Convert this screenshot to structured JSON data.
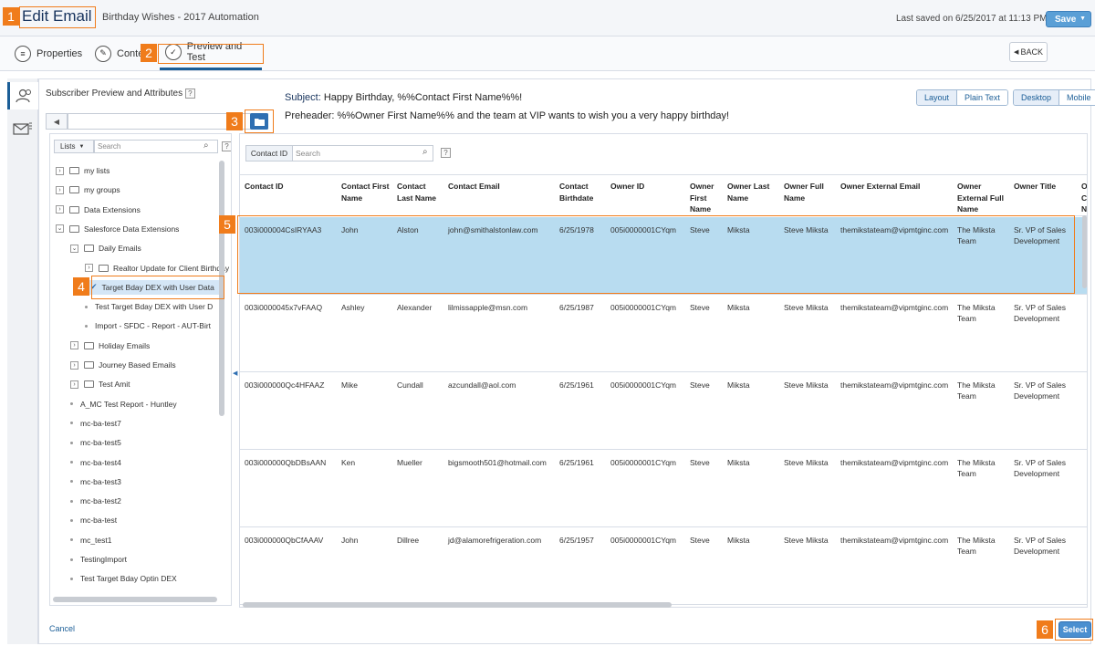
{
  "header": {
    "title": "Edit Email",
    "subtitle": "Birthday Wishes - 2017 Automation",
    "last_saved": "Last saved on 6/25/2017 at 11:13 PM",
    "save_label": "Save"
  },
  "tabs": [
    {
      "label": "Properties"
    },
    {
      "label": "Conte"
    },
    {
      "label": "Preview and Test"
    }
  ],
  "back_label": "BACK",
  "attributes_title": "Subscriber Preview and Attributes",
  "help_glyph": "?",
  "subject": {
    "label": "Subject:",
    "value": "Happy Birthday, %%Contact First Name%%!"
  },
  "preheader": {
    "label": "Preheader:",
    "value": "%%Owner First Name%% and the team at VIP wants to wish you a very happy birthday!"
  },
  "view_toggle": [
    "Layout",
    "Plain Text"
  ],
  "device_toggle": [
    "Desktop",
    "Mobile"
  ],
  "tree": {
    "lists_label": "Lists",
    "search_placeholder": "Search",
    "nodes": [
      {
        "label": "my lists",
        "type": "folder",
        "level": 0
      },
      {
        "label": "my groups",
        "type": "folder",
        "level": 0
      },
      {
        "label": "Data Extensions",
        "type": "folder",
        "level": 0
      },
      {
        "label": "Salesforce Data Extensions",
        "type": "folder-open",
        "level": 0
      },
      {
        "label": "Daily Emails",
        "type": "folder-open",
        "level": 1
      },
      {
        "label": "Realtor Update for Client Birthday",
        "type": "folder",
        "level": 2
      },
      {
        "label": "Target Bday DEX with User Data",
        "type": "selected",
        "level": 2
      },
      {
        "label": "Test Target Bday DEX with User D",
        "type": "leaf",
        "level": 2
      },
      {
        "label": "Import - SFDC - Report - AUT-Birt",
        "type": "leaf",
        "level": 2
      },
      {
        "label": "Holiday Emails",
        "type": "folder",
        "level": 1
      },
      {
        "label": "Journey Based Emails",
        "type": "folder",
        "level": 1
      },
      {
        "label": "Test Amit",
        "type": "folder",
        "level": 1
      },
      {
        "label": "A_MC Test Report - Huntley",
        "type": "leaf",
        "level": 1
      },
      {
        "label": "mc-ba-test7",
        "type": "leaf",
        "level": 1
      },
      {
        "label": "mc-ba-test5",
        "type": "leaf",
        "level": 1
      },
      {
        "label": "mc-ba-test4",
        "type": "leaf",
        "level": 1
      },
      {
        "label": "mc-ba-test3",
        "type": "leaf",
        "level": 1
      },
      {
        "label": "mc-ba-test2",
        "type": "leaf",
        "level": 1
      },
      {
        "label": "mc-ba-test",
        "type": "leaf",
        "level": 1
      },
      {
        "label": "mc_test1",
        "type": "leaf",
        "level": 1
      },
      {
        "label": "TestingImport",
        "type": "leaf",
        "level": 1
      },
      {
        "label": "Test Target Bday Optin DEX",
        "type": "leaf",
        "level": 1
      }
    ]
  },
  "grid": {
    "field_label": "Contact ID",
    "search_placeholder": "Search",
    "columns": [
      "Contact ID",
      "Contact First Name",
      "Contact Last Name",
      "Contact Email",
      "Contact Birthdate",
      "Owner ID",
      "Owner First Name",
      "Owner Last Name",
      "Owner Full Name",
      "Owner External Email",
      "Owner External Full Name",
      "Owner Title",
      "O C N"
    ],
    "rows": [
      [
        "003i000004CsIRYAA3",
        "John",
        "Alston",
        "john@smithalstonlaw.com",
        "6/25/1978",
        "005i0000001CYqm",
        "Steve",
        "Miksta",
        "Steve Miksta",
        "themikstateam@vipmtginc.com",
        "The Miksta Team",
        "Sr. VP of Sales Development"
      ],
      [
        "003i0000045x7vFAAQ",
        "Ashley",
        "Alexander",
        "lilmissapple@msn.com",
        "6/25/1987",
        "005i0000001CYqm",
        "Steve",
        "Miksta",
        "Steve Miksta",
        "themikstateam@vipmtginc.com",
        "The Miksta Team",
        "Sr. VP of Sales Development"
      ],
      [
        "003i000000Qc4HFAAZ",
        "Mike",
        "Cundall",
        "azcundall@aol.com",
        "6/25/1961",
        "005i0000001CYqm",
        "Steve",
        "Miksta",
        "Steve Miksta",
        "themikstateam@vipmtginc.com",
        "The Miksta Team",
        "Sr. VP of Sales Development"
      ],
      [
        "003i000000QbDBsAAN",
        "Ken",
        "Mueller",
        "bigsmooth501@hotmail.com",
        "6/25/1961",
        "005i0000001CYqm",
        "Steve",
        "Miksta",
        "Steve Miksta",
        "themikstateam@vipmtginc.com",
        "The Miksta Team",
        "Sr. VP of Sales Development"
      ],
      [
        "003i000000QbCfAAAV",
        "John",
        "Dillree",
        "jd@alamorefrigeration.com",
        "6/25/1957",
        "005i0000001CYqm",
        "Steve",
        "Miksta",
        "Steve Miksta",
        "themikstateam@vipmtginc.com",
        "The Miksta Team",
        "Sr. VP of Sales Development"
      ]
    ]
  },
  "cancel_label": "Cancel",
  "select_label": "Select",
  "markers": [
    "1",
    "2",
    "3",
    "4",
    "5",
    "6"
  ],
  "colors": {
    "accent": "#1b5e97",
    "marker": "#f07c1b",
    "selected_row": "#b8dcf0"
  }
}
